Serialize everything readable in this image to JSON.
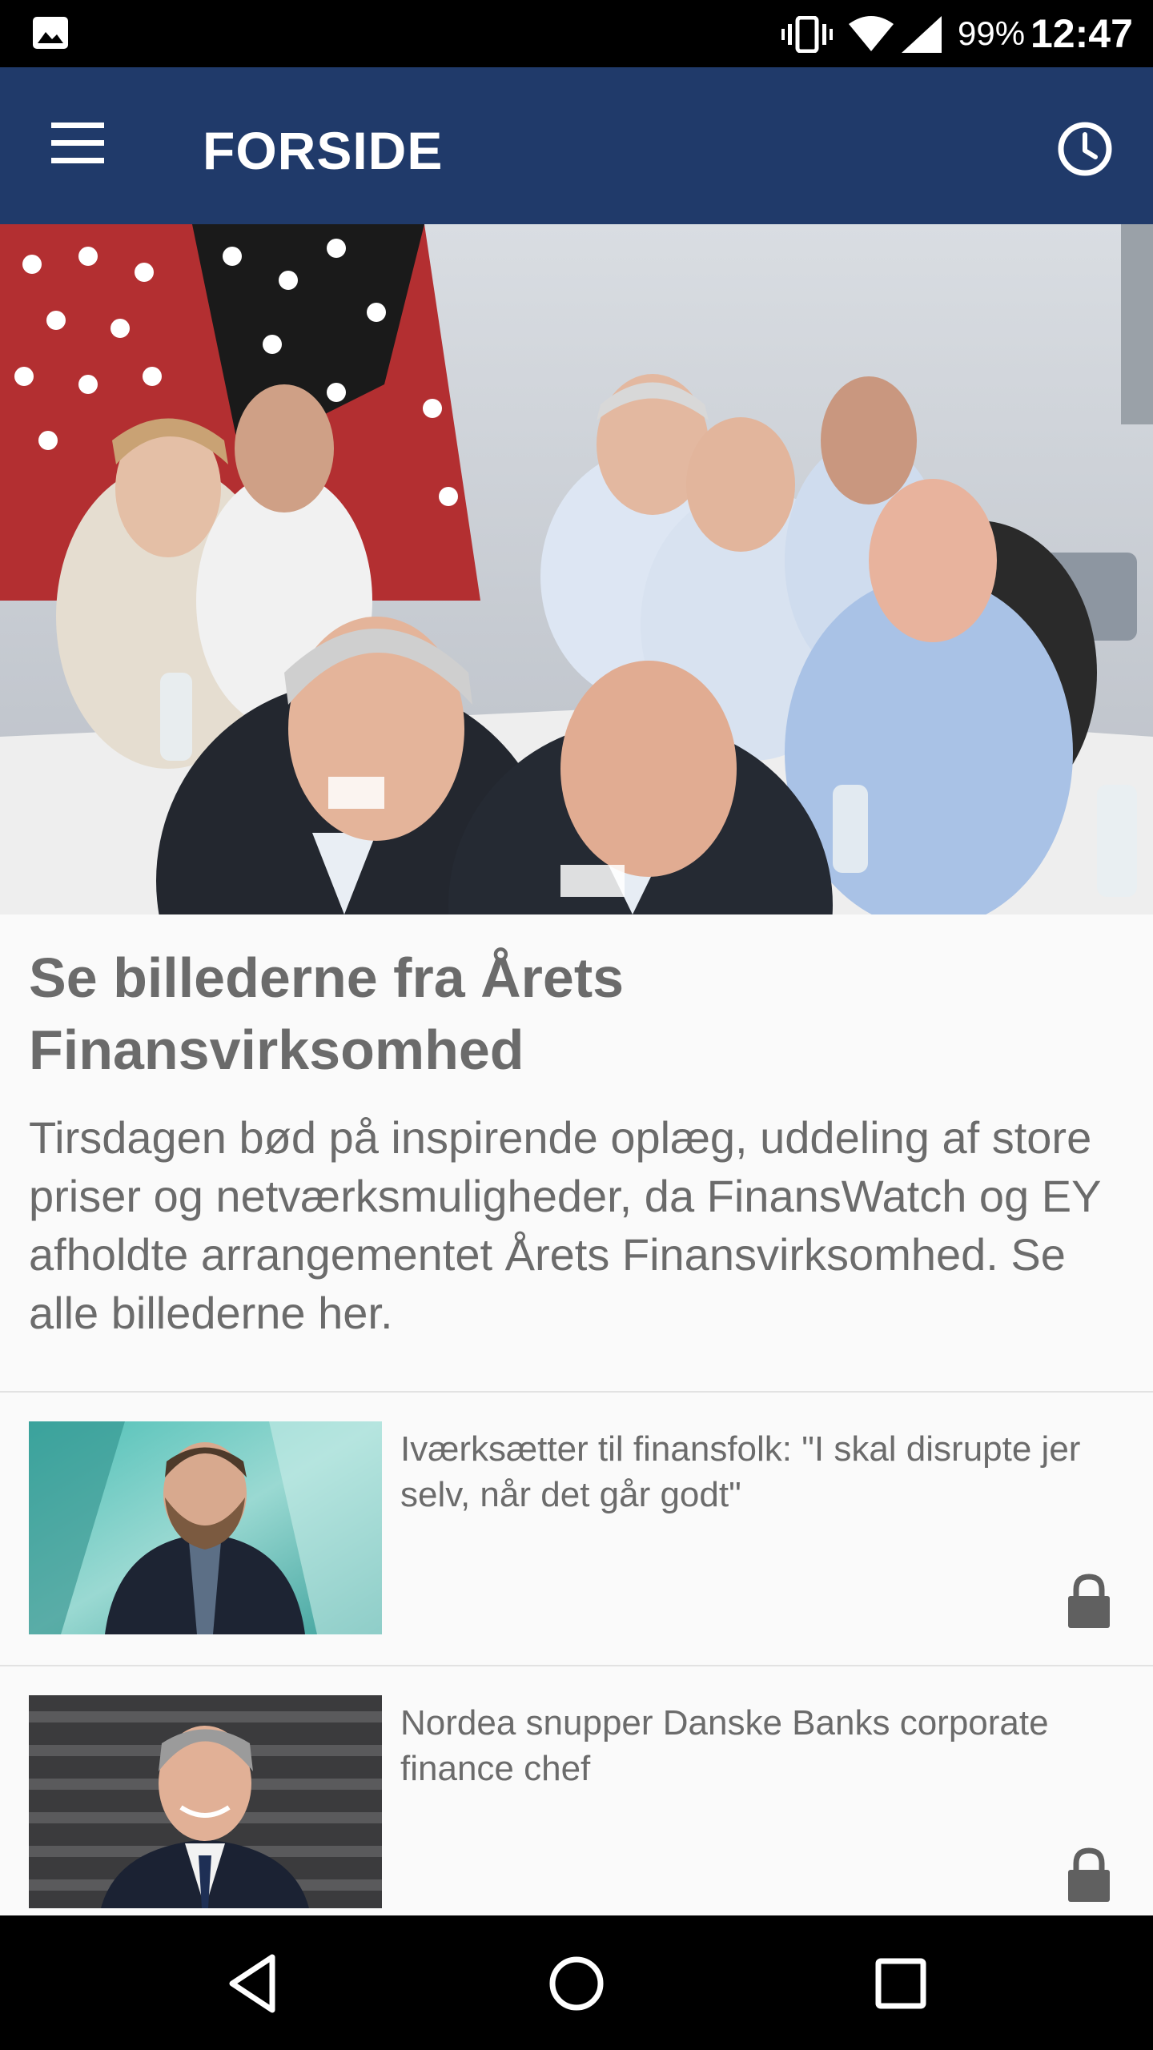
{
  "status_bar": {
    "battery": "99%",
    "time": "12:47",
    "icons": [
      "gallery-icon",
      "vibrate-icon",
      "wifi-icon",
      "signal-icon"
    ]
  },
  "app_bar": {
    "title": "FORSIDE",
    "menu_icon": "hamburger-menu-icon",
    "history_icon": "clock-icon",
    "background_color": "#203a6a"
  },
  "hero": {
    "image": "conference-audience-photo",
    "title": "Se billederne fra Årets Finansvirksomhed",
    "summary": "Tirsdagen bød på inspirende oplæg, uddeling af store priser og netværksmuligheder, da FinansWatch og EY afholdte arrangementet Årets Finansvirksomhed. Se alle billederne her."
  },
  "articles": [
    {
      "title": "Iværksætter til finansfolk: \"I skal disrupte jer selv, når det går godt\"",
      "image": "bearded-man-portrait",
      "locked": true
    },
    {
      "title": "Nordea snupper Danske Banks corporate finance chef",
      "image": "smiling-man-portrait",
      "locked": true
    }
  ],
  "nav_bar": {
    "buttons": [
      "back-icon",
      "home-icon",
      "recents-icon"
    ]
  }
}
